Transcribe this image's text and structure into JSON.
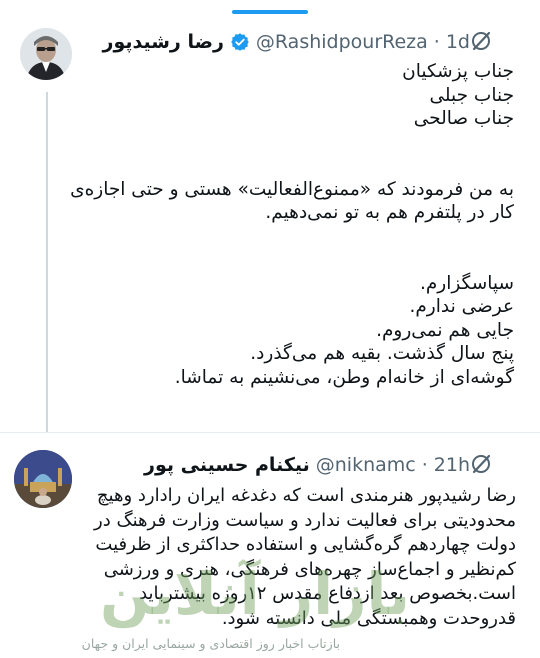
{
  "tweet1": {
    "display_name": "رضا رشیدپور",
    "handle": "@RashidpourReza",
    "separator": "·",
    "time": "1d",
    "verified": true,
    "body_lines": [
      "جناب پزشکیان",
      "جناب جبلی",
      "جناب صالحی",
      "",
      "",
      "به من فرمودند که «ممنوع‌الفعالیت» هستی و حتی اجازه‌ی",
      "کار در پلتفرم هم به تو نمی‌دهیم.",
      "",
      "",
      "سپاسگزارم.",
      "عرضی ندارم.",
      "جایی هم نمی‌روم.",
      "پنج سال گذشت. بقیه هم می‌گذرد.",
      "گوشه‌ای از خانه‌ام وطن، می‌نشینم به تماشا."
    ]
  },
  "tweet2": {
    "display_name": "نیکنام حسینی پور",
    "handle": "@niknamc",
    "separator": "·",
    "time": "21h",
    "body_lines": [
      "رضا رشیدپور هنرمندی است که دغدغه ایران رادارد وهیچ",
      "محدودیتی برای فعالیت ندارد و سیاست وزارت فرهنگ در",
      "دولت چهاردهم گره‌گشایی و استفاده حداکثری از ظرفیت",
      "کم‌نظیر و اجماع‌ساز چهره‌های فرهنگی، هنری و ورزشی",
      "است.بخصوص بعد ازدفاع مقدس ۱۲روزه بیشترباید",
      "قدروحدت وهمبستگی ملی دانسته شود."
    ]
  },
  "watermark": {
    "logo": "بازار آنلاین",
    "caption": "بازتاب اخبار روز اقتصادی و سینمایی ایران و جهان"
  },
  "icons": {
    "verified": "verified-badge-icon",
    "more": "grok-more-icon"
  },
  "colors": {
    "accent": "#1d9bf0",
    "secondary_text": "#536471",
    "thread_line": "#cfd9de"
  }
}
